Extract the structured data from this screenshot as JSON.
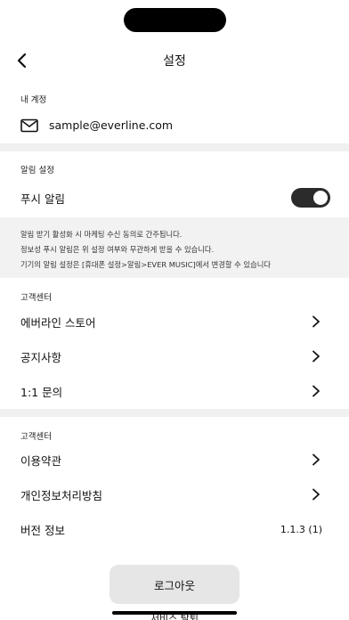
{
  "header": {
    "title": "설정"
  },
  "account": {
    "section_label": "내 계정",
    "email": "sample@everline.com"
  },
  "notifications": {
    "section_label": "알림 설정",
    "push_label": "푸시 알림",
    "push_enabled": true,
    "notice_lines": [
      "알림 받기 활성화 시 마케팅 수신 동의로 간주됩니다.",
      "정보성 푸시 알림은 위 설정 여부와 무관하게 받을 수 있습니다.",
      "기기의 알림 설정은 [휴대폰 설정>알림>EVER MUSIC]에서 변경할 수 있습니다"
    ]
  },
  "support": {
    "section_label": "고객센터",
    "items": [
      {
        "label": "에버라인 스토어"
      },
      {
        "label": "공지사항"
      },
      {
        "label": "1:1 문의"
      }
    ]
  },
  "info": {
    "section_label": "고객센터",
    "items": [
      {
        "label": "이용약관"
      },
      {
        "label": "개인정보처리방침"
      }
    ],
    "version_label": "버전 정보",
    "version_value": "1.1.3 (1)"
  },
  "actions": {
    "logout_label": "로그아웃",
    "withdraw_label": "서비스 탈퇴"
  },
  "colors": {
    "toggle_on": "#2b2b2b",
    "divider": "#f0f0f0",
    "button_bg": "#e6e6e6"
  },
  "icons": {
    "back": "chevron-left-icon",
    "mail": "mail-icon",
    "chevron": "chevron-right-icon"
  }
}
